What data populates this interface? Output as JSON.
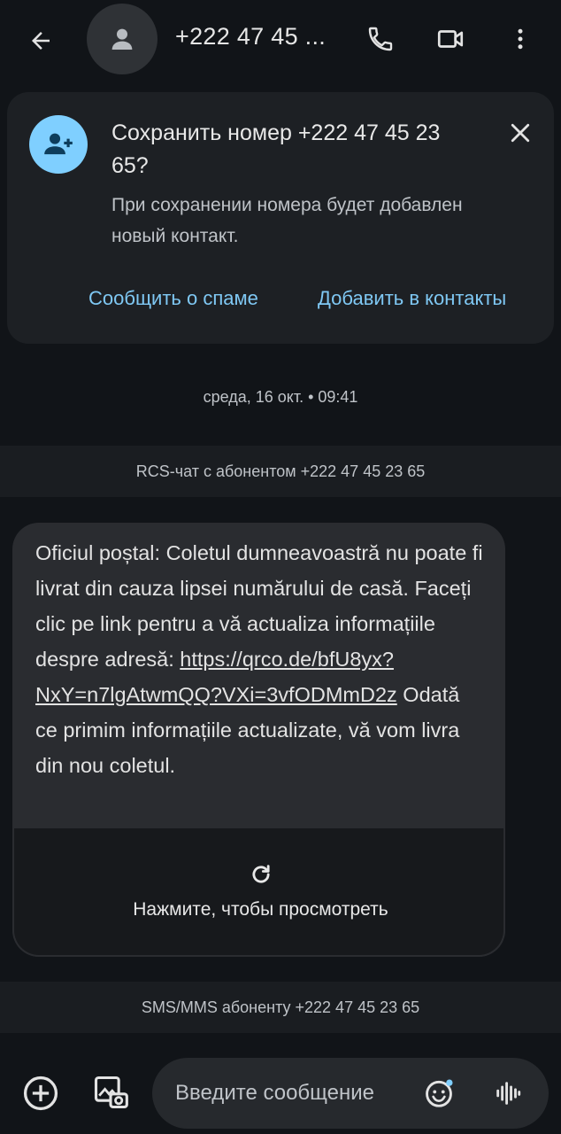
{
  "header": {
    "title": "+222 47 45 ...",
    "back_icon": "arrow-back-icon",
    "avatar_icon": "person-icon",
    "call_icon": "phone-icon",
    "video_icon": "videocam-icon",
    "more_icon": "more-vert-icon"
  },
  "save_card": {
    "title": "Сохранить номер +222 47 45 23 65?",
    "description": "При сохранении номера будет добавлен новый контакт.",
    "report_spam_label": "Сообщить о спаме",
    "add_contact_label": "Добавить в контакты",
    "avatar_color": "#7fcfff",
    "link_color": "#7fc8f4"
  },
  "conversation": {
    "date_separator": "среда, 16 окт. • 09:41",
    "rcs_notice": "RCS-чат с абонентом +222 47 45 23 65",
    "message": {
      "text_before_link": "Oficiul poștal: Coletul dumneavoastră nu poate fi livrat din cauza lipsei numărului de casă. Faceți clic pe link pentru a vă actualiza informațiile despre adresă: ",
      "link": "https://qrco.de/bfU8yx?NxY=n7lgAtwmQQ?VXi=3vfODMmD2z",
      "text_after_link": " Odată ce primim informațiile actualizate, vă vom livra din nou coletul.",
      "preview_label": "Нажмите, чтобы просмотреть"
    },
    "sms_notice": "SMS/MMS абоненту +222 47 45 23 65"
  },
  "composer": {
    "placeholder": "Введите сообщение"
  }
}
